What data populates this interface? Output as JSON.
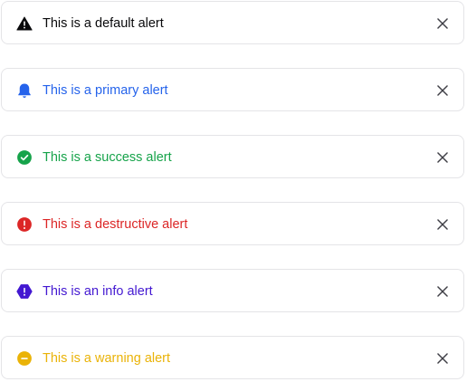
{
  "alerts": [
    {
      "variant": "default",
      "message": "This is a default alert",
      "icon": "warning-triangle-icon",
      "color": "#09090b"
    },
    {
      "variant": "primary",
      "message": "This is a primary alert",
      "icon": "bell-icon",
      "color": "#2563eb"
    },
    {
      "variant": "success",
      "message": "This is a success alert",
      "icon": "check-circle-icon",
      "color": "#16a34a"
    },
    {
      "variant": "destructive",
      "message": "This is a destructive alert",
      "icon": "exclamation-circle-icon",
      "color": "#dc2626"
    },
    {
      "variant": "info",
      "message": "This is an info alert",
      "icon": "exclamation-hexagon-icon",
      "color": "#4318d1"
    },
    {
      "variant": "warning",
      "message": "This is a warning alert",
      "icon": "minus-circle-icon",
      "color": "#eab308"
    }
  ],
  "close_icon": "close-icon",
  "border_color": "#e4e4e7"
}
